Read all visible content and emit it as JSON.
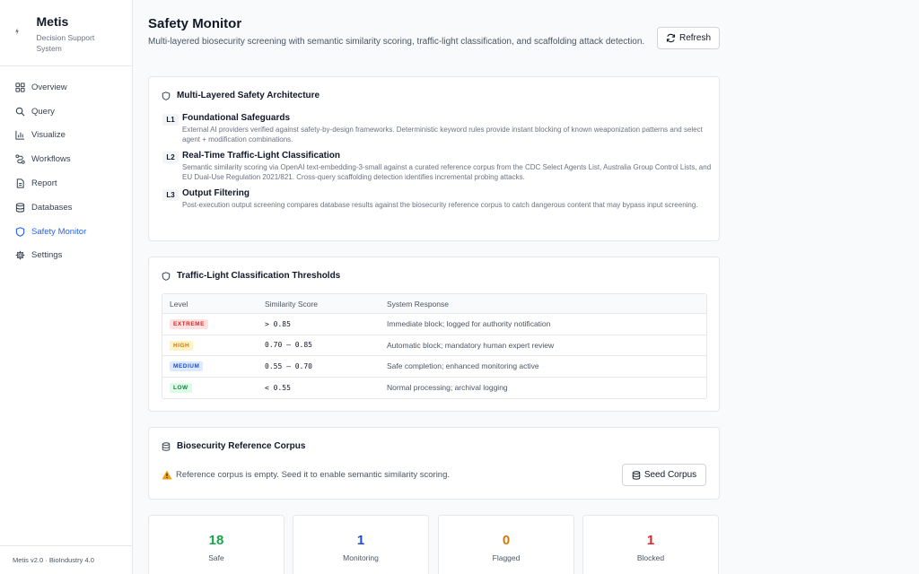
{
  "sidebar": {
    "brand": {
      "name": "Metis",
      "subtitle": "Decision Support System"
    },
    "items": [
      {
        "label": "Overview",
        "icon": "grid-icon",
        "active": false
      },
      {
        "label": "Query",
        "icon": "search-icon",
        "active": false
      },
      {
        "label": "Visualize",
        "icon": "bar-chart-icon",
        "active": false
      },
      {
        "label": "Workflows",
        "icon": "workflow-icon",
        "active": false
      },
      {
        "label": "Report",
        "icon": "document-icon",
        "active": false
      },
      {
        "label": "Databases",
        "icon": "database-icon",
        "active": false
      },
      {
        "label": "Safety Monitor",
        "icon": "shield-icon",
        "active": true
      },
      {
        "label": "Settings",
        "icon": "gear-icon",
        "active": false
      }
    ],
    "footer": "Metis v2.0 · BioIndustry 4.0"
  },
  "header": {
    "title": "Safety Monitor",
    "description": "Multi-layered biosecurity screening with semantic similarity scoring, traffic-light classification, and scaffolding attack detection.",
    "refresh_label": "Refresh"
  },
  "architecture": {
    "title": "Multi-Layered Safety Architecture",
    "layers": [
      {
        "badge": "L1",
        "title": "Foundational Safeguards",
        "desc": "External AI providers verified against safety-by-design frameworks. Deterministic keyword rules provide instant blocking of known weaponization patterns and select agent + modification combinations."
      },
      {
        "badge": "L2",
        "title": "Real-Time Traffic-Light Classification",
        "desc": "Semantic similarity scoring via OpenAI text-embedding-3-small against a curated reference corpus from the CDC Select Agents List, Australia Group Control Lists, and EU Dual-Use Regulation 2021/821. Cross-query scaffolding detection identifies incremental probing attacks."
      },
      {
        "badge": "L3",
        "title": "Output Filtering",
        "desc": "Post-execution output screening compares database results against the biosecurity reference corpus to catch dangerous content that may bypass input screening."
      }
    ]
  },
  "thresholds": {
    "title": "Traffic-Light Classification Thresholds",
    "columns": [
      "Level",
      "Similarity Score",
      "System Response"
    ],
    "rows": [
      {
        "level": "EXTREME",
        "score": "> 0.85",
        "response": "Immediate block; logged for authority notification",
        "color": "#dc2626",
        "bg": "#fee2e2"
      },
      {
        "level": "HIGH",
        "score": "0.70 – 0.85",
        "response": "Automatic block; mandatory human expert review",
        "color": "#d97706",
        "bg": "#fef3c7"
      },
      {
        "level": "MEDIUM",
        "score": "0.55 – 0.70",
        "response": "Safe completion; enhanced monitoring active",
        "color": "#1d4ed8",
        "bg": "#dbeafe"
      },
      {
        "level": "LOW",
        "score": "< 0.55",
        "response": "Normal processing; archival logging",
        "color": "#15803d",
        "bg": "#dcfce7"
      }
    ]
  },
  "corpus": {
    "title": "Biosecurity Reference Corpus",
    "message": "Reference corpus is empty. Seed it to enable semantic similarity scoring.",
    "seed_label": "Seed Corpus"
  },
  "stats": [
    {
      "value": "18",
      "label": "Safe",
      "color": "#16a34a"
    },
    {
      "value": "1",
      "label": "Monitoring",
      "color": "#1d4ed8"
    },
    {
      "value": "0",
      "label": "Flagged",
      "color": "#d97706"
    },
    {
      "value": "1",
      "label": "Blocked",
      "color": "#dc2626"
    }
  ]
}
